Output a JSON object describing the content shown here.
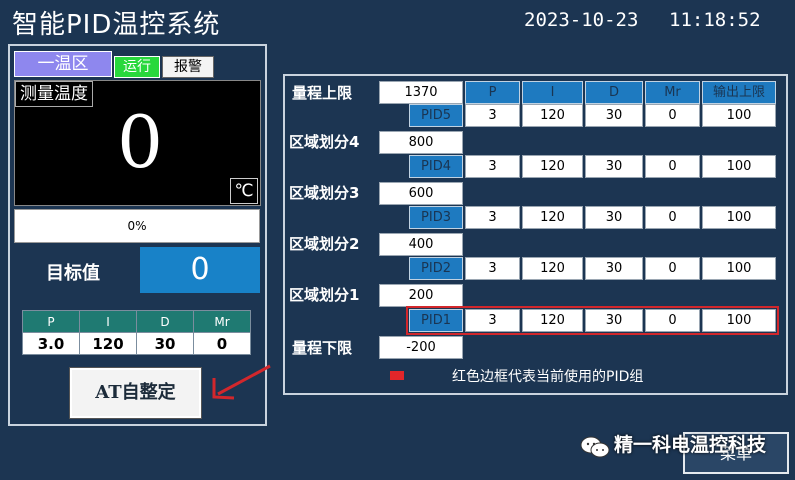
{
  "header": {
    "title": "智能PID温控系统",
    "date": "2023-10-23",
    "time": "11:18:52"
  },
  "zone": {
    "tab_label": "一温区",
    "status_run": "运行",
    "status_alarm": "报警",
    "measure_label": "测量温度",
    "measure_value": "0",
    "unit": "℃",
    "output_percent_text": "0%",
    "output_fraction": 0,
    "target_label": "目标值",
    "target_value": "0",
    "pid_headers": [
      "P",
      "I",
      "D",
      "Mr"
    ],
    "pid_values": [
      "3.0",
      "120",
      "30",
      "0"
    ],
    "autotune_label": "AT自整定"
  },
  "params": {
    "upper_label": "量程上限",
    "upper_value": "1370",
    "lower_label": "量程下限",
    "lower_value": "-200",
    "column_headers": [
      "P",
      "I",
      "D",
      "Mr",
      "输出上限"
    ],
    "divisions": [
      {
        "label": "区域划分4",
        "value": "800"
      },
      {
        "label": "区域划分3",
        "value": "600"
      },
      {
        "label": "区域划分2",
        "value": "400"
      },
      {
        "label": "区域划分1",
        "value": "200"
      }
    ],
    "pid_groups": [
      {
        "name": "PID5",
        "p": "3",
        "i": "120",
        "d": "30",
        "mr": "0",
        "out": "100"
      },
      {
        "name": "PID4",
        "p": "3",
        "i": "120",
        "d": "30",
        "mr": "0",
        "out": "100"
      },
      {
        "name": "PID3",
        "p": "3",
        "i": "120",
        "d": "30",
        "mr": "0",
        "out": "100"
      },
      {
        "name": "PID2",
        "p": "3",
        "i": "120",
        "d": "30",
        "mr": "0",
        "out": "100"
      },
      {
        "name": "PID1",
        "p": "3",
        "i": "120",
        "d": "30",
        "mr": "0",
        "out": "100"
      }
    ],
    "active_group": "PID1",
    "legend_text": "红色边框代表当前使用的PID组"
  },
  "footer": {
    "watermark": "精一科电温控科技",
    "menu_label": "菜单"
  },
  "colors": {
    "background": "#1c3552",
    "active_border": "#d2272c",
    "header_cell": "#1e7ac0",
    "run_green": "#28d83c"
  }
}
